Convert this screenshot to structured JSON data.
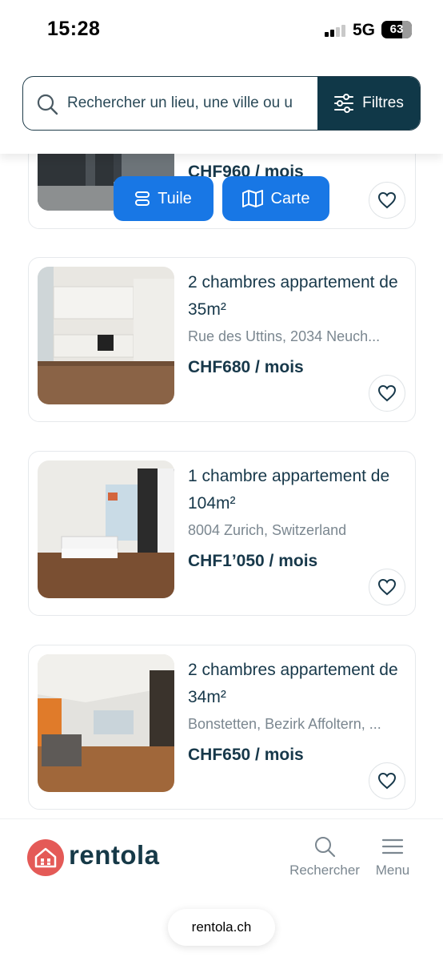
{
  "status_bar": {
    "time": "15:28",
    "network": "5G",
    "battery": "63"
  },
  "search": {
    "placeholder": "Rechercher un lieu, une ville ou u",
    "filters_label": "Filtres"
  },
  "view_toggle": {
    "tile_label": "Tuile",
    "map_label": "Carte"
  },
  "listings": [
    {
      "title": "",
      "address": "",
      "price": "CHF960 / mois"
    },
    {
      "title": "2 chambres appartement de 35m²",
      "address": "Rue des Uttins, 2034 Neuch...",
      "price": "CHF680 / mois"
    },
    {
      "title": "1 chambre appartement de 104m²",
      "address": "8004 Zurich, Switzerland",
      "price": "CHF1’050 / mois"
    },
    {
      "title": "2 chambres appartement de 34m²",
      "address": "Bonstetten, Bezirk Affoltern, ...",
      "price": "CHF650 / mois"
    }
  ],
  "brand": {
    "name": "rentola"
  },
  "nav": {
    "search_label": "Rechercher",
    "menu_label": "Menu"
  },
  "browser": {
    "url": "rentola.ch"
  },
  "colors": {
    "brand_dark": "#103848",
    "accent_blue": "#1877e5",
    "logo_red": "#e45a57"
  },
  "icons": [
    "search-icon",
    "sliders-icon",
    "heart-icon",
    "tile-icon",
    "map-icon",
    "home-icon",
    "menu-icon"
  ]
}
